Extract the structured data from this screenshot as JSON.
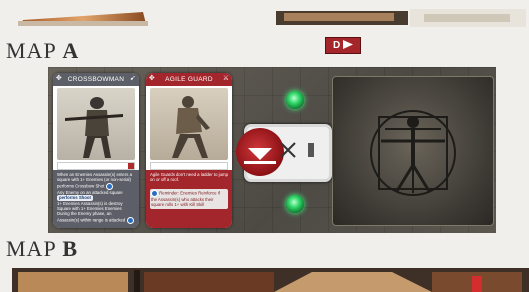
{
  "top_strip": {},
  "badge": {
    "label": "D"
  },
  "map_a": {
    "label_prefix": "MAP ",
    "label_letter": "A"
  },
  "map_b": {
    "label_prefix": "MAP ",
    "label_letter": "B"
  },
  "cards": [
    {
      "title": "CROSSBOWMAN",
      "header_color": "#5c5f67",
      "body_color": "#5c5f67",
      "lines": [
        "When an Enemies Assassin(s) enters a square with 1+ Enemies (or non-serial)",
        "performs Crossbow Shot",
        "Any Enemy on an attacked square",
        "performs Shoot",
        "1+ Enemies Assassin(s) is destroy",
        "Square with 1+ Enemies Enemies",
        "During the Enemy phase, an",
        "Assassin(s) within range is attacked"
      ]
    },
    {
      "title": "AGILE GUARD",
      "header_color": "#a3262c",
      "body_color": "#a3262c",
      "lines": [
        "Agile Guards don't need a ladder to jump on or off a roof.",
        "Reminder: Enemies Reinforce if the Assassin(s) who attacks their square rolls 1+ with Kill Skill"
      ]
    }
  ]
}
